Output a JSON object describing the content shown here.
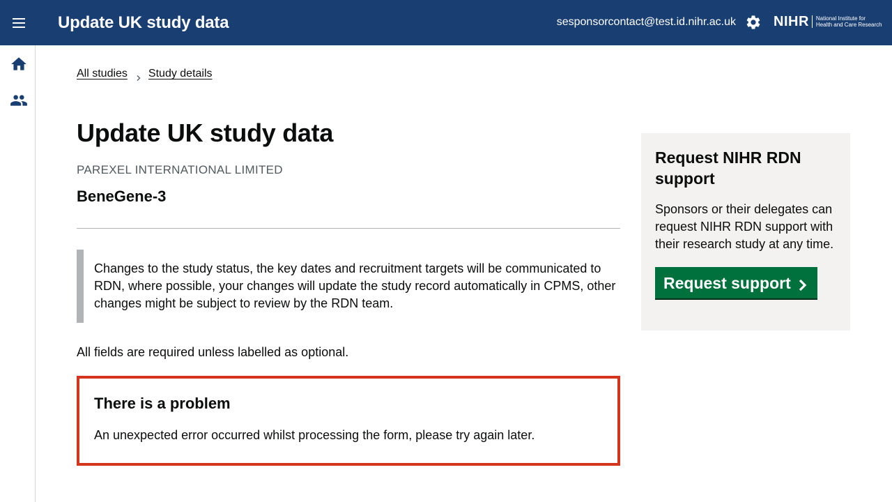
{
  "header": {
    "app_title": "Update UK study data",
    "user_email": "sesponsorcontact@test.id.nihr.ac.uk",
    "menu_icon": "menu-icon",
    "settings_icon": "gear-icon",
    "logo_mark": "NIHR",
    "logo_text_line1": "National Institute for",
    "logo_text_line2": "Health and Care Research",
    "background_color": "#193e72"
  },
  "sidebar": {
    "items": [
      {
        "icon": "home-icon"
      },
      {
        "icon": "people-icon"
      }
    ]
  },
  "breadcrumb": {
    "items": [
      "All studies",
      "Study details"
    ]
  },
  "main": {
    "title": "Update UK study data",
    "organisation": "PAREXEL INTERNATIONAL LIMITED",
    "study_name": "BeneGene-3",
    "inset_text": "Changes to the study status, the key dates and recruitment targets will be communicated to RDN, where possible, your changes will update the study record automatically in CPMS, other changes might be subject to review by the RDN team.",
    "required_note": "All fields are required unless labelled as optional."
  },
  "error_summary": {
    "title": "There is a problem",
    "message": "An unexpected error occurred whilst processing the form, please try again later.",
    "border_color": "#d4351c"
  },
  "support_panel": {
    "title": "Request NIHR RDN support",
    "text": "Sponsors or their delegates can request NIHR RDN support with their research study at any time.",
    "button_label": "Request support",
    "button_color": "#00703c"
  }
}
